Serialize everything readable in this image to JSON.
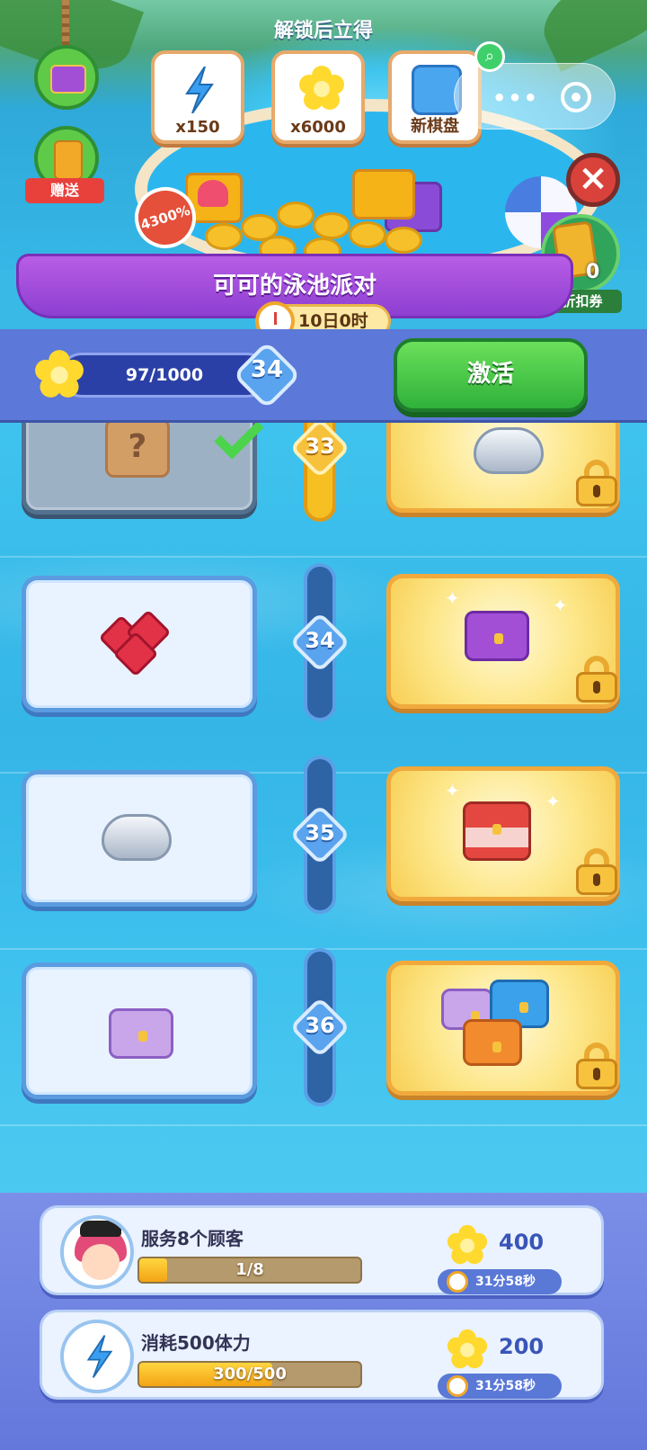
{
  "banner": {
    "title": "解锁后立得",
    "rewards": [
      {
        "label": "x150",
        "icon": "energy-bolt-icon"
      },
      {
        "label": "x6000",
        "icon": "flower-coin-icon"
      },
      {
        "label": "新棋盘",
        "icon": "board-tile-icon"
      }
    ],
    "burst_text": "4300%",
    "side_gift_label": "赠送",
    "coupon_label": "折扣券",
    "coupon_count": "0"
  },
  "event": {
    "title": "可可的泳池派对",
    "timer": "10日0时"
  },
  "progress": {
    "text": "97/1000",
    "level": "34",
    "activate_label": "激活"
  },
  "levels": [
    {
      "num": "33",
      "free_item": "mystery-box",
      "free_claimed": true,
      "paid_item": "shell"
    },
    {
      "num": "34",
      "free_item": "ruby-gems",
      "free_claimed": false,
      "paid_item": "purple-chest"
    },
    {
      "num": "35",
      "free_item": "shell",
      "free_claimed": false,
      "paid_item": "red-chest"
    },
    {
      "num": "36",
      "free_item": "pale-chest",
      "free_claimed": false,
      "paid_item": "chest-bundle"
    }
  ],
  "tasks": [
    {
      "title": "服务8个顾客",
      "progress_text": "1/8",
      "progress": 0.125,
      "reward": "400",
      "timer": "31分58秒",
      "icon": "customer-avatar"
    },
    {
      "title": "消耗500体力",
      "progress_text": "300/500",
      "progress": 0.6,
      "reward": "200",
      "timer": "31分58秒",
      "icon": "energy-bolt-icon"
    }
  ],
  "colors": {
    "accent_green": "#2fb13a",
    "event_purple": "#8d3fd1",
    "strip_blue": "#5c78d8",
    "gold": "#f7c33e"
  }
}
